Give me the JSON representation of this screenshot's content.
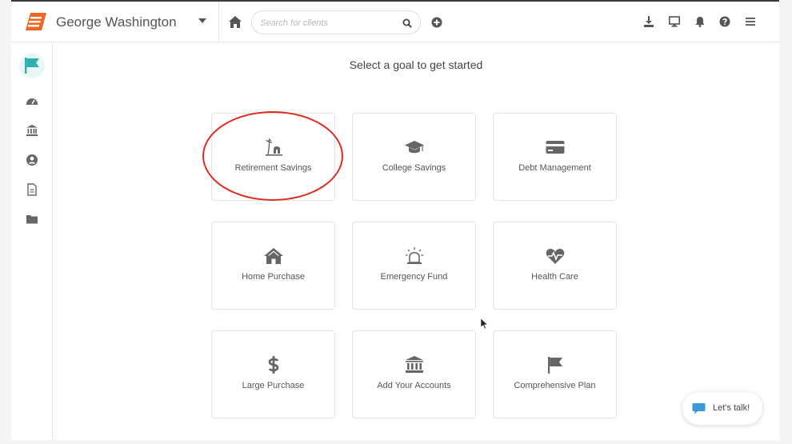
{
  "header": {
    "user_name": "George Washington",
    "search_placeholder": "Search for clients",
    "brand_color": "#f26522"
  },
  "icons": {
    "logo": "brand-logo",
    "home": "home-icon",
    "search": "search-icon",
    "add": "plus-circle-icon",
    "right": [
      "download-icon",
      "monitor-icon",
      "bell-icon",
      "help-icon",
      "menu-icon"
    ]
  },
  "sidebar": {
    "items": [
      {
        "icon": "flag-icon",
        "active": true
      },
      {
        "icon": "dashboard-icon",
        "active": false
      },
      {
        "icon": "bank-icon",
        "active": false
      },
      {
        "icon": "user-icon",
        "active": false
      },
      {
        "icon": "document-icon",
        "active": false
      },
      {
        "icon": "folder-icon",
        "active": false
      }
    ],
    "active_color": "#2bb3b1"
  },
  "main": {
    "headline": "Select a goal to get started",
    "goals": [
      {
        "label": "Retirement Savings",
        "icon": "beach-icon"
      },
      {
        "label": "College Savings",
        "icon": "graduation-cap-icon"
      },
      {
        "label": "Debt Management",
        "icon": "credit-card-icon"
      },
      {
        "label": "Home Purchase",
        "icon": "house-icon"
      },
      {
        "label": "Emergency Fund",
        "icon": "siren-icon"
      },
      {
        "label": "Health Care",
        "icon": "heartbeat-icon"
      },
      {
        "label": "Large Purchase",
        "icon": "dollar-icon"
      },
      {
        "label": "Add Your Accounts",
        "icon": "bank-icon"
      },
      {
        "label": "Comprehensive Plan",
        "icon": "flag-icon"
      }
    ]
  },
  "chat": {
    "label": "Let's talk!",
    "icon_color": "#3a9ad9"
  }
}
